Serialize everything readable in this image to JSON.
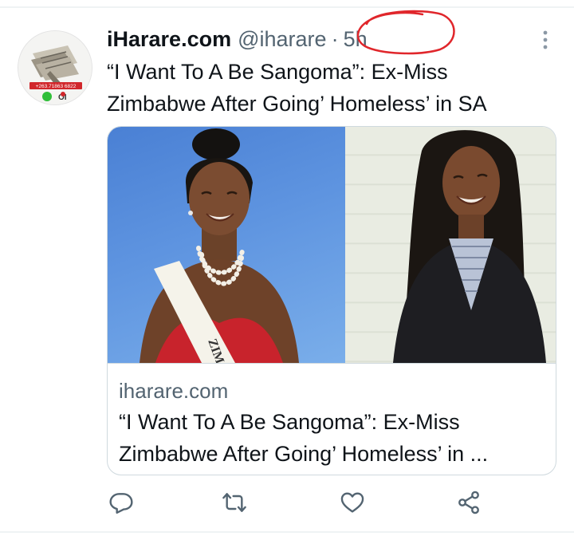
{
  "tweet": {
    "display_name": "iHarare.com",
    "handle": "@iharare",
    "separator": "·",
    "time": "5h",
    "text_line1": "“I Want To A Be Sangoma”: Ex-Miss",
    "text_line2": "Zimbabwe After Going’ Homeless’ in SA"
  },
  "avatar": {
    "icon": "newspaper-logo-icon",
    "phone_text": "+263.71863 6822"
  },
  "card": {
    "domain": "iharare.com",
    "title_line1": "“I Want To A Be Sangoma”: Ex-Miss",
    "title_line2": "Zimbabwe After Going’ Homeless’ in ...",
    "images": [
      {
        "name": "pageant-photo",
        "sash_text": "ZIM"
      },
      {
        "name": "portrait-photo"
      }
    ]
  },
  "actions": [
    {
      "name": "reply-icon"
    },
    {
      "name": "retweet-icon"
    },
    {
      "name": "like-icon"
    },
    {
      "name": "share-icon"
    }
  ],
  "colors": {
    "secondary_text": "#536471",
    "annotation_circle": "#e0262b",
    "border": "#cfd9de"
  }
}
